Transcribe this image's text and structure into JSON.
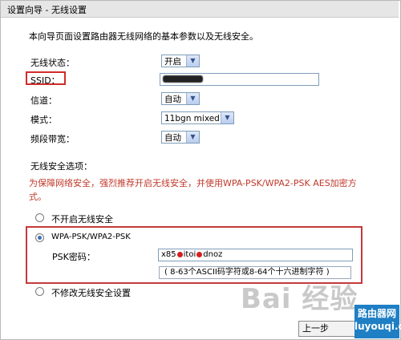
{
  "window": {
    "title": "设置向导 - 无线设置"
  },
  "intro": "本向导页面设置路由器无线网络的基本参数以及无线安全。",
  "fields": {
    "wireless_status": {
      "label": "无线状态：",
      "value": "开启"
    },
    "ssid": {
      "label": "SSID：",
      "value": ""
    },
    "channel": {
      "label": "信道：",
      "value": "自动"
    },
    "mode": {
      "label": "模式：",
      "value": "11bgn mixed"
    },
    "bandwidth": {
      "label": "频段带宽：",
      "value": "自动"
    }
  },
  "security": {
    "heading": "无线安全选项：",
    "warning": "为保障网络安全，强烈推荐开启无线安全，并使用WPA-PSK/WPA2-PSK AES加密方式。",
    "options": [
      {
        "label": "不开启无线安全",
        "selected": false
      },
      {
        "label": "WPA-PSK/WPA2-PSK",
        "selected": true
      },
      {
        "label": "不修改无线安全设置",
        "selected": false
      }
    ],
    "psk_label": "PSK密码：",
    "psk_value_a": "x85",
    "psk_value_b": "itoi",
    "psk_value_c": "dnoz",
    "psk_hint": "( 8-63个ASCII码字符或8-64个十六进制字符 )"
  },
  "buttons": {
    "prev": "上一步"
  },
  "watermark": {
    "text": "Bai 经验",
    "site_a": "路由器网",
    "site_b": "luyouqi.com"
  },
  "colors": {
    "highlight_red": "#d12b2b",
    "warning_red": "#c0392b"
  }
}
